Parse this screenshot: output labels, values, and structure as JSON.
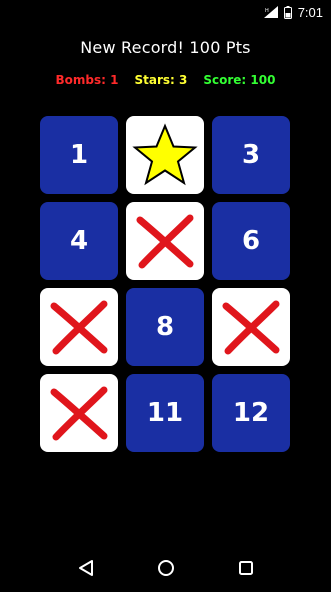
{
  "status_bar": {
    "time": "7:01",
    "icons": [
      "signal-icon",
      "battery-icon"
    ]
  },
  "header": {
    "title": "New Record! 100 Pts",
    "stats": [
      {
        "label": "Bombs: 1",
        "color": "#ff2a2a"
      },
      {
        "label": "Stars: 3",
        "color": "#ffff33"
      },
      {
        "label": "Score: 100",
        "color": "#33ff33"
      }
    ]
  },
  "board": {
    "cells": [
      {
        "type": "number",
        "label": "1"
      },
      {
        "type": "star",
        "icon": "star-icon"
      },
      {
        "type": "number",
        "label": "3"
      },
      {
        "type": "number",
        "label": "4"
      },
      {
        "type": "bomb",
        "icon": "red-x-icon"
      },
      {
        "type": "number",
        "label": "6"
      },
      {
        "type": "bomb",
        "icon": "red-x-icon"
      },
      {
        "type": "number",
        "label": "8"
      },
      {
        "type": "bomb",
        "icon": "red-x-icon"
      },
      {
        "type": "bomb",
        "icon": "red-x-icon"
      },
      {
        "type": "number",
        "label": "11"
      },
      {
        "type": "number",
        "label": "12"
      }
    ],
    "colors": {
      "tile": "#1a2fa3",
      "revealed": "#ffffff",
      "x": "#e0161c",
      "star": "#ffff00"
    }
  },
  "nav_bar": {
    "icons": [
      "back-icon",
      "home-icon",
      "recents-icon"
    ]
  }
}
